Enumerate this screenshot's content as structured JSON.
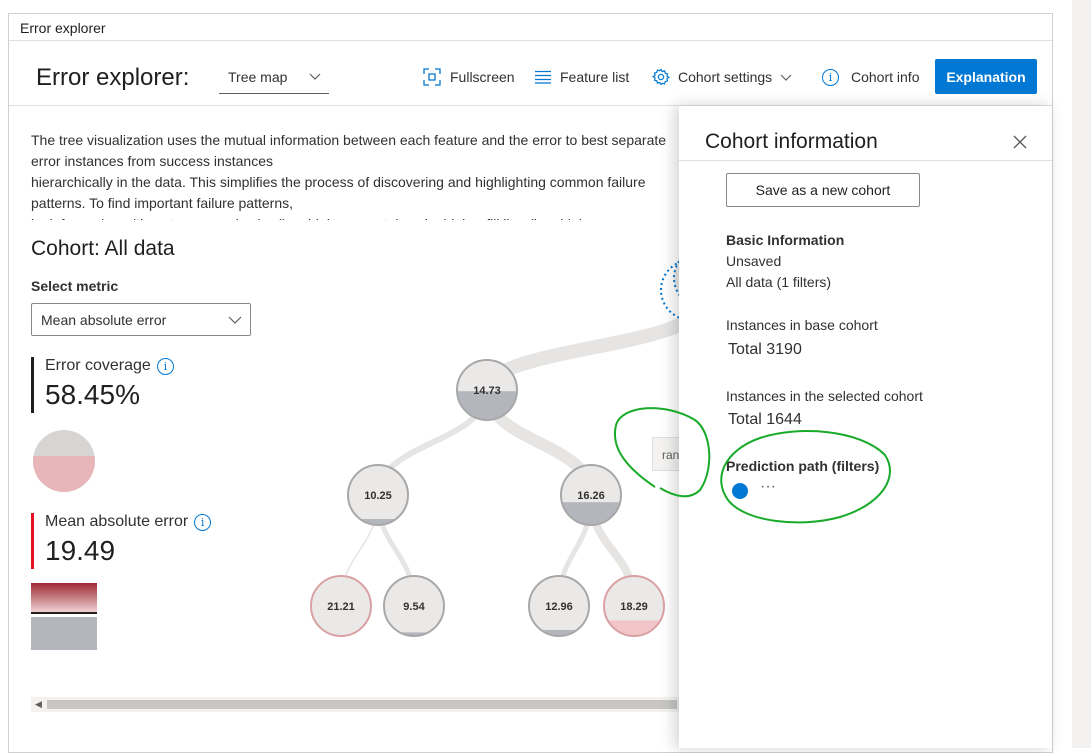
{
  "frame_title": "Error explorer",
  "header": {
    "title": "Error explorer:",
    "view_select": "Tree map",
    "toolbar": {
      "fullscreen": "Fullscreen",
      "feature_list": "Feature list",
      "cohort_settings": "Cohort settings",
      "cohort_info": "Cohort info",
      "explanation": "Explanation"
    }
  },
  "description": "The tree visualization uses the mutual information between each feature and the error to best separate error instances from success instances\nhierarchically in the data. This simplifies the process of discovering and highlighting common failure patterns. To find important failure patterns,\nlook for nodes with a stronger red color (i.e., high error rate) and a higher fill line (i.e., high error coverage). To edit the list of features being used in\nthe tree, click on \"Feature list.\"",
  "left": {
    "cohort_title": "Cohort: All data",
    "select_metric_label": "Select metric",
    "metric_selected": "Mean absolute error",
    "error_coverage_label": "Error coverage",
    "error_coverage_value": "58.45%",
    "error_coverage_fraction": 0.5845,
    "mae_label": "Mean absolute error",
    "mae_value": "19.49"
  },
  "tree": {
    "nodes": [
      {
        "id": "n1",
        "label": "14.73",
        "fill": 0.48,
        "error": false
      },
      {
        "id": "n2",
        "label": "10.25",
        "fill": 0.1,
        "error": false
      },
      {
        "id": "n3",
        "label": "16.26",
        "fill": 0.38,
        "error": false
      },
      {
        "id": "n4",
        "label": "21.21",
        "fill": 0.0,
        "error": true
      },
      {
        "id": "n5",
        "label": "9.54",
        "fill": 0.06,
        "error": false
      },
      {
        "id": "n6",
        "label": "12.96",
        "fill": 0.1,
        "error": false
      },
      {
        "id": "n7",
        "label": "18.29",
        "fill": 0.26,
        "error": true
      }
    ],
    "tooltip_text": "ran"
  },
  "panel": {
    "title": "Cohort information",
    "save_button": "Save as a new cohort",
    "basic_info_title": "Basic Information",
    "basic_info_status": "Unsaved",
    "basic_info_filters": "All data (1 filters)",
    "base_cohort_label": "Instances in base cohort",
    "base_cohort_total": "Total 3190",
    "selected_cohort_label": "Instances in the selected cohort",
    "selected_cohort_total": "Total 1644",
    "prediction_path_label": "Prediction path (filters)",
    "prediction_path_more": "···"
  },
  "colors": {
    "accent": "#0078d4",
    "error_red": "#e81123",
    "annotation_green": "#1aaa2a"
  }
}
